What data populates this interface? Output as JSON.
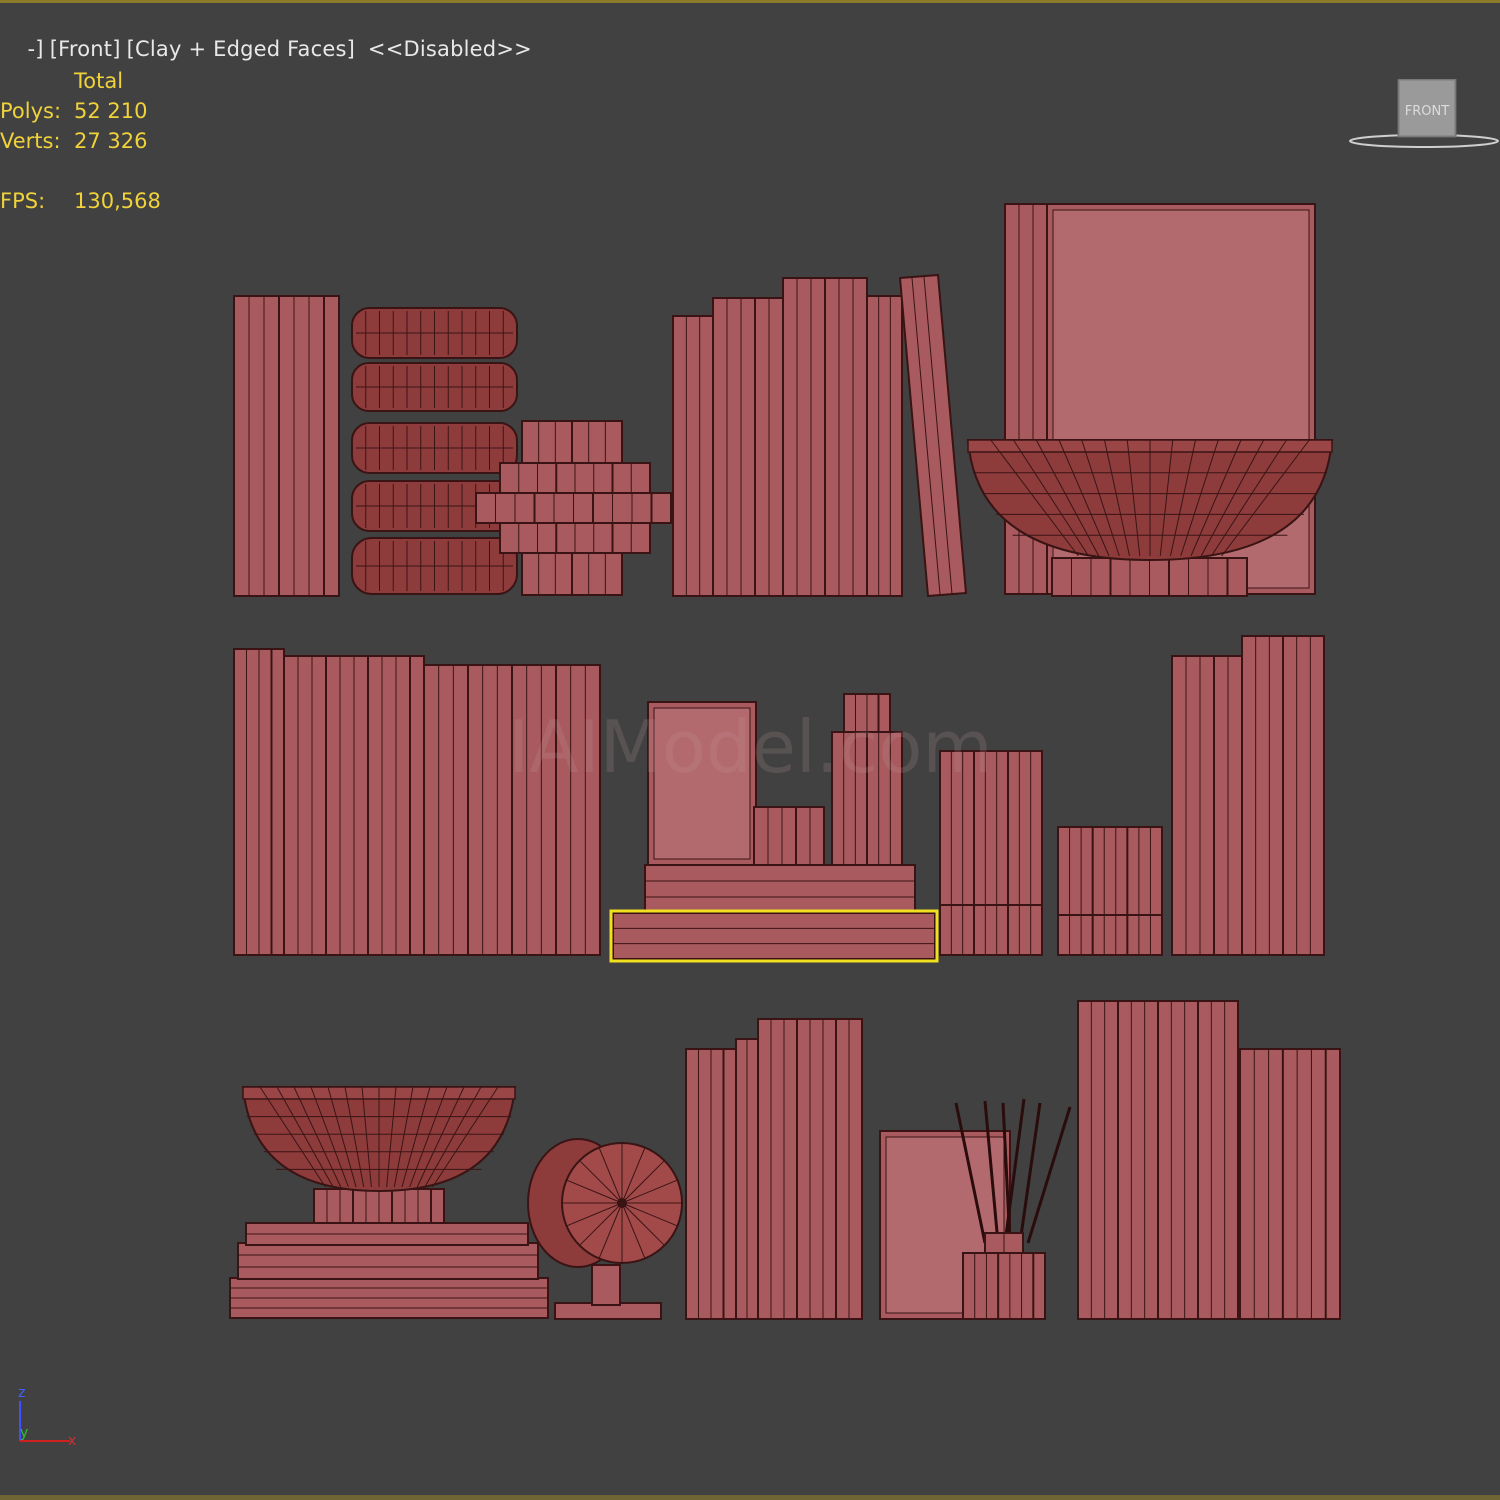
{
  "viewport": {
    "label_parts": [
      "-]",
      "[Front]",
      "[Clay + Edged Faces]",
      "<<Disabled>>"
    ],
    "stats": {
      "header": "Total",
      "rows": [
        {
          "key": "Polys:",
          "value": "52 210"
        },
        {
          "key": "Verts:",
          "value": "27 326"
        },
        {
          "key": "FPS:",
          "value": "130,568"
        }
      ]
    },
    "viewcube_label": "FRONT",
    "watermark": "IAIModel.com",
    "axis": {
      "z": "z",
      "y": "y",
      "x": "x"
    }
  },
  "colors": {
    "background": "#414141",
    "model_fill": "#a85a5e",
    "model_dark": "#8e3b3b",
    "edge": "#3a1414",
    "selection": "#f0e020",
    "stats_text": "#f0d23a"
  },
  "icons": [
    "viewcube-icon",
    "axis-tripod-icon"
  ]
}
